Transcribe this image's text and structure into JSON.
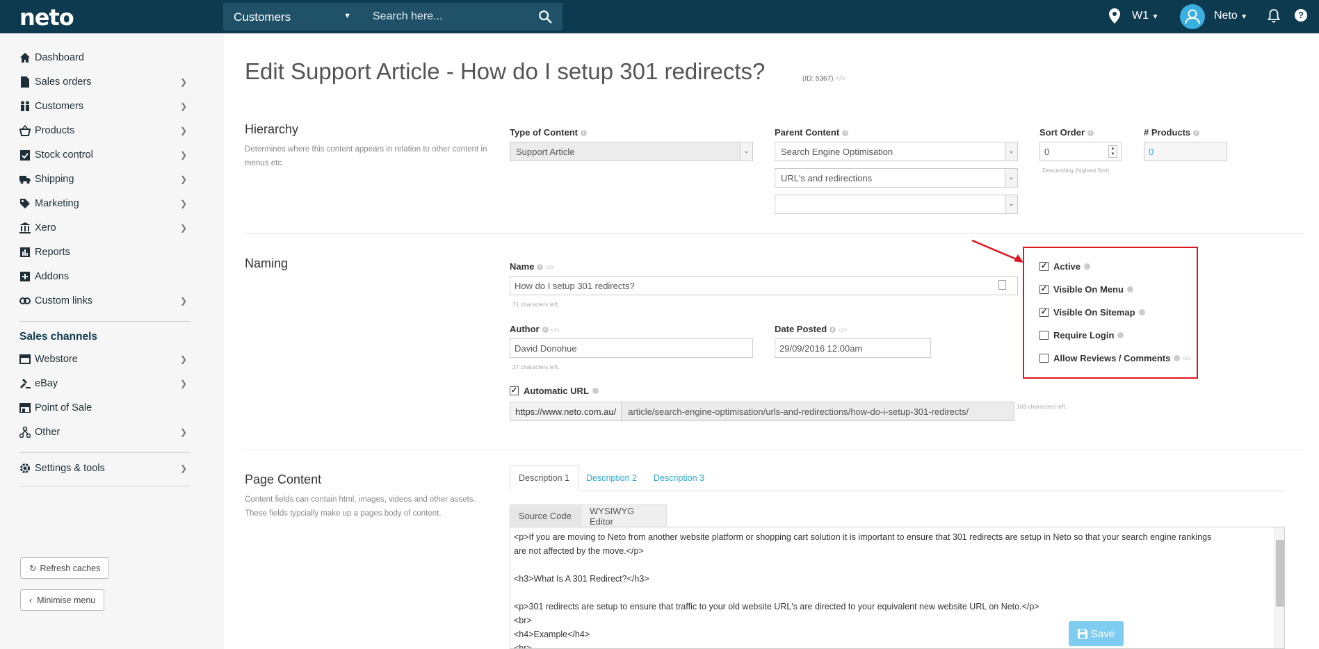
{
  "topbar": {
    "logo": "neto",
    "search_type": "Customers",
    "search_placeholder": "Search here...",
    "location": "W1",
    "user": "Neto",
    "help": "?"
  },
  "sidebar": {
    "items": [
      {
        "label": "Dashboard",
        "icon": "home-icon"
      },
      {
        "label": "Sales orders",
        "icon": "document-icon"
      },
      {
        "label": "Customers",
        "icon": "people-icon"
      },
      {
        "label": "Products",
        "icon": "basket-icon"
      },
      {
        "label": "Stock control",
        "icon": "clipboard-check-icon"
      },
      {
        "label": "Shipping",
        "icon": "truck-icon"
      },
      {
        "label": "Marketing",
        "icon": "tag-icon"
      },
      {
        "label": "Xero",
        "icon": "bank-icon"
      },
      {
        "label": "Reports",
        "icon": "bar-chart-icon"
      },
      {
        "label": "Addons",
        "icon": "plus-square-icon"
      },
      {
        "label": "Custom links",
        "icon": "link-icon"
      }
    ],
    "channels_heading": "Sales channels",
    "channels": [
      {
        "label": "Webstore",
        "icon": "webstore-icon"
      },
      {
        "label": "eBay",
        "icon": "gavel-icon"
      },
      {
        "label": "Point of Sale",
        "icon": "store-icon"
      },
      {
        "label": "Other",
        "icon": "network-icon"
      }
    ],
    "settings": "Settings & tools",
    "refresh_caches": "Refresh caches",
    "minimise_menu": "Minimise menu"
  },
  "page": {
    "title": "Edit Support Article - How do I setup 301 redirects?",
    "id": "(ID: 5367)"
  },
  "hierarchy": {
    "title": "Hierarchy",
    "description": "Determines where this content appears in relation to other content in menus etc.",
    "type_label": "Type of Content",
    "type_value": "Support Article",
    "parent_label": "Parent Content",
    "parent_values": [
      "Search Engine Optimisation",
      "URL's and redirections",
      ""
    ],
    "sort_label": "Sort Order",
    "sort_value": "0",
    "sort_hint": "Descending (highest first)",
    "products_label": "# Products",
    "products_value": "0"
  },
  "naming": {
    "title": "Naming",
    "name_label": "Name",
    "name_value": "How do I setup 301 redirects?",
    "name_hint": "71 characters left.",
    "author_label": "Author",
    "author_value": "David Donohue",
    "author_hint": "37 characters left.",
    "date_label": "Date Posted",
    "date_value": "29/09/2016 12:00am",
    "auto_url_label": "Automatic URL",
    "url_prefix": "https://www.neto.com.au/",
    "url_value": "article/search-engine-optimisation/urls-and-redirections/how-do-i-setup-301-redirects/",
    "url_hint": "169 characters left.",
    "checkboxes": [
      {
        "label": "Active",
        "checked": true
      },
      {
        "label": "Visible On Menu",
        "checked": true
      },
      {
        "label": "Visible On Sitemap",
        "checked": true
      },
      {
        "label": "Require Login",
        "checked": false
      },
      {
        "label": "Allow Reviews / Comments",
        "checked": false
      }
    ]
  },
  "page_content": {
    "title": "Page Content",
    "description": "Content fields can contain html, images, videos and other assets. These fields typcially make up a pages body of content.",
    "tabs": [
      "Description 1",
      "Description 2",
      "Description 3"
    ],
    "editor_modes": [
      "Source Code",
      "WYSIWYG Editor"
    ],
    "code_lines": [
      "<p>If you are moving to Neto from another website platform or shopping cart solution it is important to ensure that 301 redirects are setup in Neto so that your search engine rankings",
      "are not affected by the move.</p>",
      "",
      "<h3>What Is A 301 Redirect?</h3>",
      "",
      "<p>301 redirects are setup to ensure that traffic to your old website URL's are directed to your equivalent new website URL on Neto.</p>",
      "<br>",
      "<h4>Example</h4>",
      "<br>"
    ],
    "save_label": "Save"
  },
  "colors": {
    "topbar": "#0e3a4f",
    "accent": "#2ba6d8",
    "highlight": "#e0141e"
  }
}
